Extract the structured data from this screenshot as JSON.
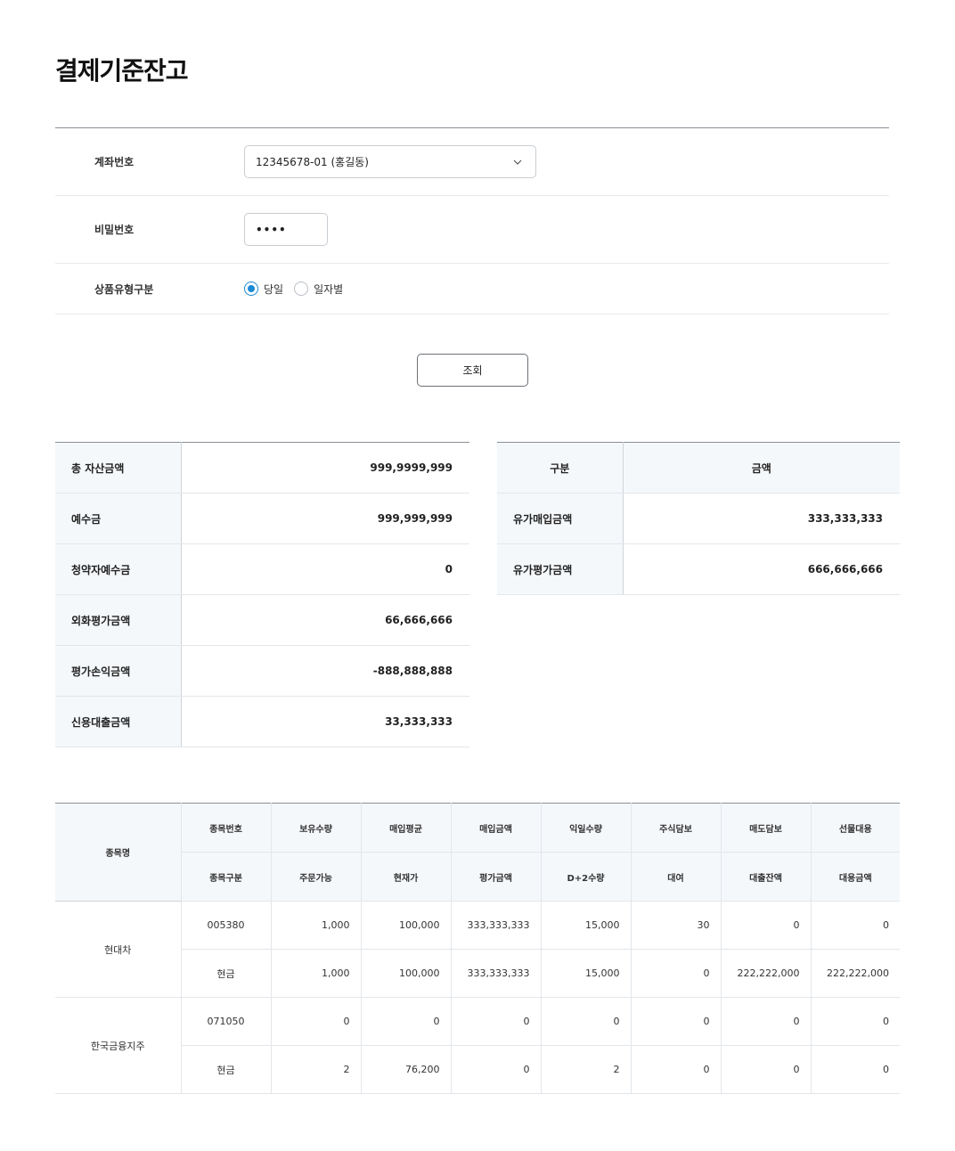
{
  "page": {
    "title": "결제기준잔고"
  },
  "form": {
    "account_label": "계좌번호",
    "account_value": "12345678-01 (홍길동)",
    "password_label": "비밀번호",
    "password_value": "••••",
    "product_label": "상품유형구분",
    "radio_options": [
      {
        "label": "당일",
        "selected": true
      },
      {
        "label": "일자별",
        "selected": false
      }
    ],
    "search_button": "조회"
  },
  "summary_left": [
    {
      "label": "총 자산금액",
      "value": "999,9999,999"
    },
    {
      "label": "예수금",
      "value": "999,999,999"
    },
    {
      "label": "청약자예수금",
      "value": "0"
    },
    {
      "label": "외화평가금액",
      "value": "66,666,666"
    },
    {
      "label": "평가손익금액",
      "value": "-888,888,888"
    },
    {
      "label": "신용대출금액",
      "value": "33,333,333"
    }
  ],
  "summary_right": {
    "headers": [
      "구분",
      "금액"
    ],
    "rows": [
      {
        "label": "유가매입금액",
        "value": "333,333,333"
      },
      {
        "label": "유가평가금액",
        "value": "666,666,666"
      }
    ]
  },
  "holdings": {
    "name_header": "종목명",
    "header_row1": [
      "종목번호",
      "보유수량",
      "매입평균",
      "매입금액",
      "익일수량",
      "주식담보",
      "매도담보",
      "선물대용"
    ],
    "header_row2": [
      "종목구분",
      "주문가능",
      "현재가",
      "평가금액",
      "D+2수량",
      "대여",
      "대출잔액",
      "대용금액"
    ],
    "items": [
      {
        "name": "현대차",
        "row1": [
          "005380",
          "1,000",
          "100,000",
          "333,333,333",
          "15,000",
          "30",
          "0",
          "0"
        ],
        "row2": [
          "현금",
          "1,000",
          "100,000",
          "333,333,333",
          "15,000",
          "0",
          "222,222,000",
          "222,222,000"
        ]
      },
      {
        "name": "한국금융지주",
        "row1": [
          "071050",
          "0",
          "0",
          "0",
          "0",
          "0",
          "0",
          "0"
        ],
        "row2": [
          "현금",
          "2",
          "76,200",
          "0",
          "2",
          "0",
          "0",
          "0"
        ]
      }
    ]
  }
}
